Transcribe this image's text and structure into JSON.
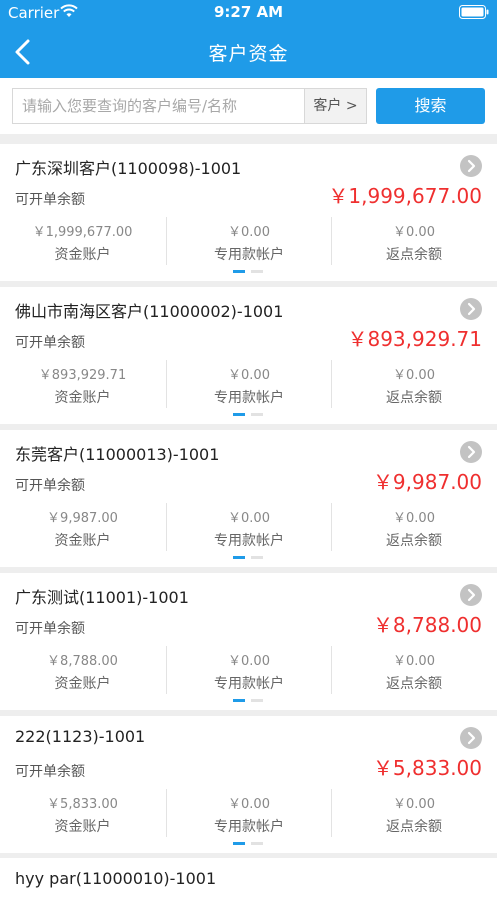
{
  "status": {
    "carrier": "Carrier",
    "time": "9:27 AM"
  },
  "nav": {
    "title": "客户资金"
  },
  "search": {
    "placeholder": "请输入您要查询的客户编号/名称",
    "scope": "客户 >",
    "button": "搜索"
  },
  "colors": {
    "brand": "#1f9be8",
    "amount": "#ef2f2f"
  },
  "cards": [
    {
      "title": "广东深圳客户(1100098)-1001",
      "label": "可开单余额",
      "amount": "￥1,999,677.00",
      "metrics": [
        {
          "value": "￥1,999,677.00",
          "name": "资金账户"
        },
        {
          "value": "￥0.00",
          "name": "专用款帐户"
        },
        {
          "value": "￥0.00",
          "name": "返点余额"
        }
      ]
    },
    {
      "title": "佛山市南海区客户(11000002)-1001",
      "label": "可开单余额",
      "amount": "￥893,929.71",
      "metrics": [
        {
          "value": "￥893,929.71",
          "name": "资金账户"
        },
        {
          "value": "￥0.00",
          "name": "专用款帐户"
        },
        {
          "value": "￥0.00",
          "name": "返点余额"
        }
      ]
    },
    {
      "title": "东莞客户(11000013)-1001",
      "label": "可开单余额",
      "amount": "￥9,987.00",
      "metrics": [
        {
          "value": "￥9,987.00",
          "name": "资金账户"
        },
        {
          "value": "￥0.00",
          "name": "专用款帐户"
        },
        {
          "value": "￥0.00",
          "name": "返点余额"
        }
      ]
    },
    {
      "title": "广东测试(11001)-1001",
      "label": "可开单余额",
      "amount": "￥8,788.00",
      "metrics": [
        {
          "value": "￥8,788.00",
          "name": "资金账户"
        },
        {
          "value": "￥0.00",
          "name": "专用款帐户"
        },
        {
          "value": "￥0.00",
          "name": "返点余额"
        }
      ]
    },
    {
      "title": "222(1123)-1001",
      "label": "可开单余额",
      "amount": "￥5,833.00",
      "metrics": [
        {
          "value": "￥5,833.00",
          "name": "资金账户"
        },
        {
          "value": "￥0.00",
          "name": "专用款帐户"
        },
        {
          "value": "￥0.00",
          "name": "返点余额"
        }
      ]
    }
  ],
  "partial_card": {
    "title": "hyy par(11000010)-1001"
  }
}
